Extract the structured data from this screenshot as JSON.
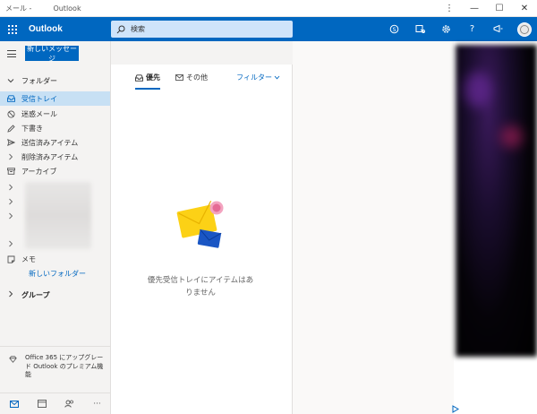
{
  "window": {
    "title_left": "メール -",
    "title_app": "Outlook",
    "controls": {
      "more": "⋮",
      "minimize": "—",
      "maximize": "☐",
      "close": "✕"
    }
  },
  "header": {
    "brand": "Outlook",
    "search_placeholder": "検索",
    "icons": [
      "skype-icon",
      "meet-icon",
      "settings-icon",
      "help-icon",
      "feedback-icon",
      "avatar"
    ]
  },
  "sidebar": {
    "new_message_label": "新しいメッセージ",
    "folders_heading": "フォルダー",
    "items": [
      {
        "label": "受信トレイ",
        "icon": "inbox-icon",
        "selected": true
      },
      {
        "label": "迷惑メール",
        "icon": "junk-icon",
        "selected": false
      },
      {
        "label": "下書き",
        "icon": "pencil-icon",
        "selected": false
      },
      {
        "label": "送信済みアイテム",
        "icon": "send-icon",
        "selected": false
      },
      {
        "label": "削除済みアイテム",
        "icon": "chevron-right-icon",
        "selected": false
      },
      {
        "label": "アーカイブ",
        "icon": "archive-icon",
        "selected": false
      }
    ],
    "notes_label": "メモ",
    "new_folder_label": "新しいフォルダー",
    "groups_label": "グループ",
    "upsell_text": "Office 365 にアップグレード Outlook のプレミアム機能"
  },
  "list": {
    "tab_focused": "優先",
    "tab_other": "その他",
    "filter_label": "フィルター",
    "empty_text": "優先受信トレイにアイテムはありません"
  },
  "colors": {
    "brand_blue": "#0067c0",
    "selected_bg": "#c7e0f4",
    "search_bg": "#cfe4fa"
  }
}
